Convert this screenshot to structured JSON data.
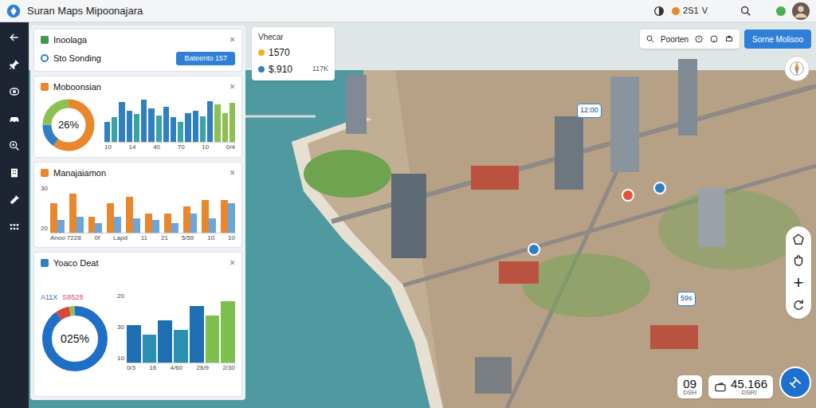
{
  "window": {
    "title": "Suran Maps Mipoonajara"
  },
  "top_bar": {
    "badge": "2S1",
    "menu": "V"
  },
  "panels": [
    {
      "kind": "row",
      "title": "Inoolaga",
      "close": "×",
      "icon_color": "#3f9a4a",
      "row": {
        "label": "Sto Sonding",
        "button": "Bateento 157"
      }
    },
    {
      "kind": "donut-bars",
      "title": "Moboonsian",
      "close": "×",
      "icon_color": "#e8872c",
      "tags": [],
      "donut": {
        "label": "26%",
        "segments": [
          {
            "value": 0.6,
            "color": "#e8872c"
          },
          {
            "value": 0.15,
            "color": "#2f7fc1"
          },
          {
            "value": 0.25,
            "color": "#8cc152"
          }
        ]
      },
      "chart": {
        "max": 100,
        "y_ticks": [],
        "bars": [
          {
            "value": 45,
            "color": "#2f7fc1"
          },
          {
            "value": 55,
            "color": "#3aa3a8"
          },
          {
            "value": 90,
            "color": "#2f7fc1"
          },
          {
            "value": 70,
            "color": "#2f7fc1"
          },
          {
            "value": 62,
            "color": "#3aa3a8"
          },
          {
            "value": 95,
            "color": "#2f7fc1"
          },
          {
            "value": 75,
            "color": "#2f7fc1"
          },
          {
            "value": 60,
            "color": "#3aa3a8"
          },
          {
            "value": 80,
            "color": "#2f7fc1"
          },
          {
            "value": 55,
            "color": "#2f7fc1"
          },
          {
            "value": 45,
            "color": "#3aa3a8"
          },
          {
            "value": 65,
            "color": "#2f7fc1"
          },
          {
            "value": 70,
            "color": "#2f7fc1"
          },
          {
            "value": 58,
            "color": "#3aa3a8"
          },
          {
            "value": 92,
            "color": "#2f7fc1"
          },
          {
            "value": 85,
            "color": "#8cc152"
          },
          {
            "value": 65,
            "color": "#8cc152"
          },
          {
            "value": 88,
            "color": "#8cc152"
          }
        ],
        "x_labels": [
          "10",
          "14",
          "40",
          "70",
          "10",
          "0/4"
        ]
      }
    },
    {
      "kind": "grouped-bars",
      "title": "Manajaiamon",
      "close": "×",
      "icon_color": "#e8872c",
      "chart": {
        "max": 30,
        "y_ticks": [
          "30",
          "20"
        ],
        "series": [
          {
            "color": "#e8872c",
            "values": [
              18,
              24,
              10,
              18,
              22,
              12,
              12,
              16,
              20,
              20
            ]
          },
          {
            "color": "#6aa6dc",
            "values": [
              8,
              10,
              6,
              10,
              9,
              8,
              6,
              12,
              9,
              18
            ]
          }
        ],
        "x_labels": [
          "Anoo 7228",
          "0f",
          "Lapd",
          "11",
          "21",
          "5/59",
          "10",
          "10"
        ]
      }
    },
    {
      "kind": "donut-bars",
      "title": "Yoaco Deat",
      "close": "×",
      "icon_color": "#2f7fc1",
      "tags": [
        {
          "text": "A11X",
          "color": "#2f6fc1"
        },
        {
          "text": "S8528",
          "color": "#e0457b"
        }
      ],
      "donut": {
        "label": "025%",
        "segments": [
          {
            "value": 0.9,
            "color": "#1f6fc8"
          },
          {
            "value": 0.07,
            "color": "#d9463b"
          },
          {
            "value": 0.03,
            "color": "#8cc152"
          }
        ]
      },
      "chart": {
        "max": 30,
        "y_ticks": [
          "20",
          "30",
          "10"
        ],
        "bars": [
          {
            "value": 16,
            "color": "#1f6fb5"
          },
          {
            "value": 12,
            "color": "#2a8fb0"
          },
          {
            "value": 18,
            "color": "#1f6fb5"
          },
          {
            "value": 14,
            "color": "#2a8fb0"
          },
          {
            "value": 24,
            "color": "#1f6fb5"
          },
          {
            "value": 20,
            "color": "#7cbf4f"
          },
          {
            "value": 26,
            "color": "#7cbf4f"
          }
        ],
        "x_labels": [
          "0/3",
          "16",
          "4/60",
          "26/9",
          "2/30"
        ]
      }
    }
  ],
  "info_card": {
    "title": "Vhecar",
    "rows": [
      {
        "value": "1570",
        "color": "#f2b01e"
      },
      {
        "value": "$.910",
        "note": "117K",
        "color": "#2f7fc1"
      }
    ]
  },
  "toolbar": {
    "label": "Poorten",
    "button": "Sorne Molisoo"
  },
  "map": {
    "pins": [
      {
        "label": "12:00"
      },
      {
        "label": "59s"
      }
    ],
    "markers": [
      {
        "color": "#2f7fc1"
      },
      {
        "color": "#e0533d"
      },
      {
        "color": "#2f7fc1"
      }
    ]
  },
  "zoom": {
    "zoom_in": "+"
  },
  "bottom_stats": [
    {
      "value": "09",
      "label": "DSH"
    },
    {
      "value": "45.166",
      "label": "DSRI"
    }
  ]
}
